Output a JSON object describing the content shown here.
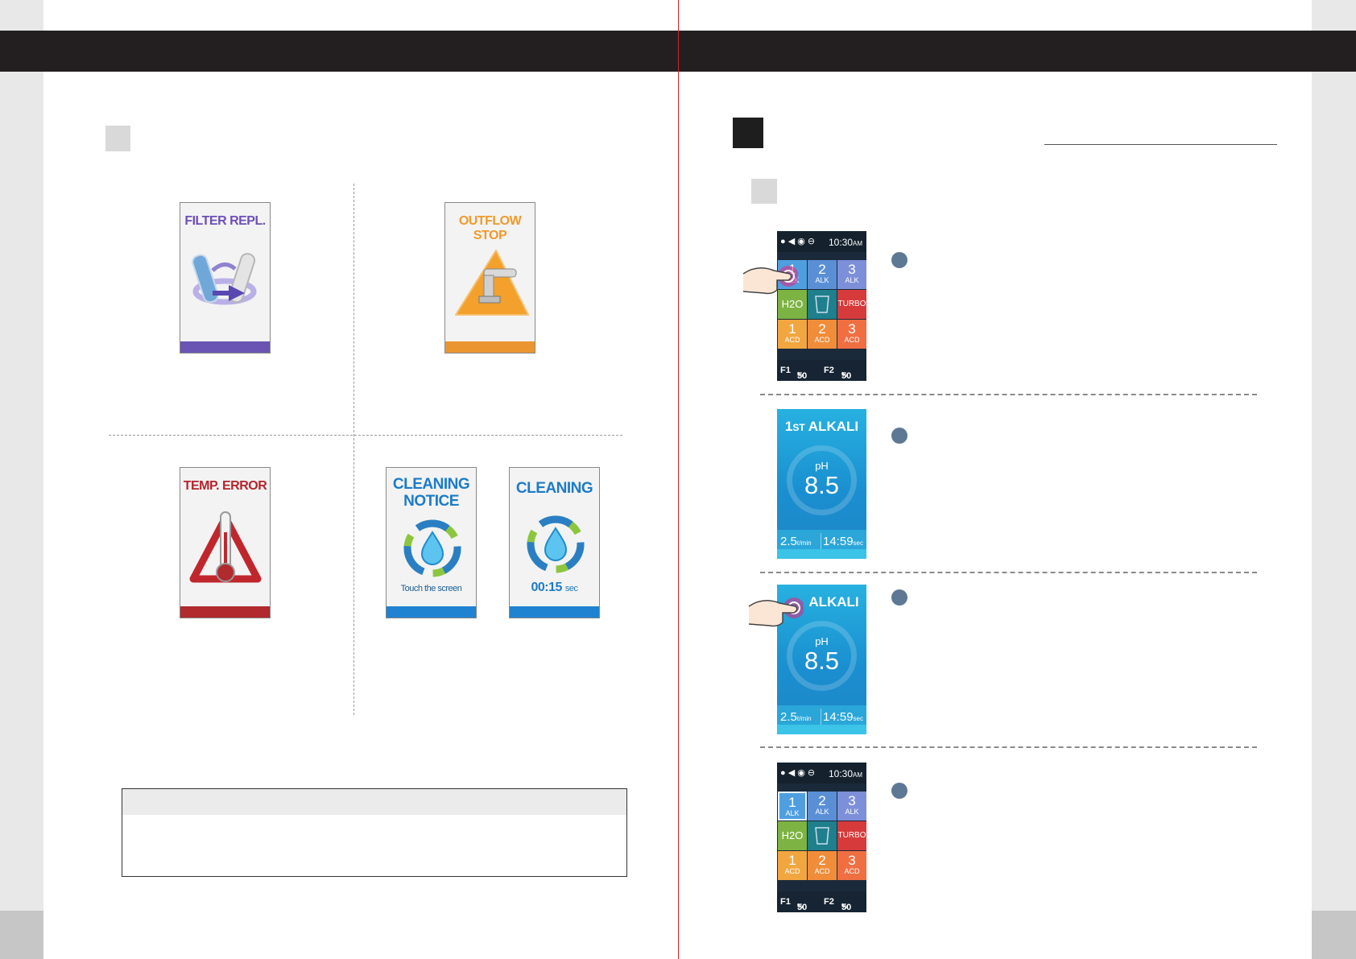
{
  "left_page": {
    "cards": [
      {
        "title": "FILTER REPL.",
        "title_color": "#6d4fb6",
        "bar_color": "#6a56b2",
        "icon": "filter-replace-icon"
      },
      {
        "title": "OUTFLOW STOP",
        "title_color": "#ef9a2c",
        "bar_color": "#eb9530",
        "icon": "outflow-stop-icon"
      },
      {
        "title": "TEMP. ERROR",
        "title_color": "#b3252d",
        "bar_color": "#b02a2e",
        "icon": "thermometer-warning-icon"
      },
      {
        "title_line1": "CLEANING",
        "title_line2": "NOTICE",
        "caption": "Touch the screen",
        "title_color": "#1c7cc7",
        "bar_color": "#1f83d1",
        "icon": "water-drop-cycle-icon"
      },
      {
        "title": "CLEANING",
        "timer": "00:15",
        "timer_unit": "sec",
        "title_color": "#1c7cc7",
        "bar_color": "#1f83d1",
        "icon": "water-drop-cycle-icon"
      }
    ]
  },
  "right_page": {
    "menu_screen": {
      "time": "10:30",
      "time_suffix": "AM",
      "tiles": [
        {
          "n": "1",
          "s": "ALK",
          "color": "#4f9fe0"
        },
        {
          "n": "2",
          "s": "ALK",
          "color": "#5a8fd6"
        },
        {
          "n": "3",
          "s": "ALK",
          "color": "#7d8fd8"
        },
        {
          "n": "H2O",
          "s": "",
          "color": "#7cb342"
        },
        {
          "n": "",
          "s": "",
          "color": "#1f7f8c"
        },
        {
          "n": "TURBO",
          "s": "",
          "color": "#d63a3a"
        },
        {
          "n": "1",
          "s": "ACD",
          "color": "#f2a640"
        },
        {
          "n": "2",
          "s": "ACD",
          "color": "#f08d3a"
        },
        {
          "n": "3",
          "s": "ACD",
          "color": "#ef6f43"
        }
      ],
      "footer": {
        "f1_label": "F1",
        "f1_value": "50",
        "f2_label": "F2",
        "f2_value": "50",
        "unit": "%"
      }
    },
    "ph_screen": {
      "title_num": "1",
      "title_suffix": "ST",
      "title_word": "ALKALI",
      "title_word_only": "ALKALI",
      "ph_label": "pH",
      "ph_value": "8.5",
      "flow_value": "2.5",
      "flow_unit": "ℓ/min",
      "time_value": "14:59",
      "time_unit": "sec"
    }
  }
}
